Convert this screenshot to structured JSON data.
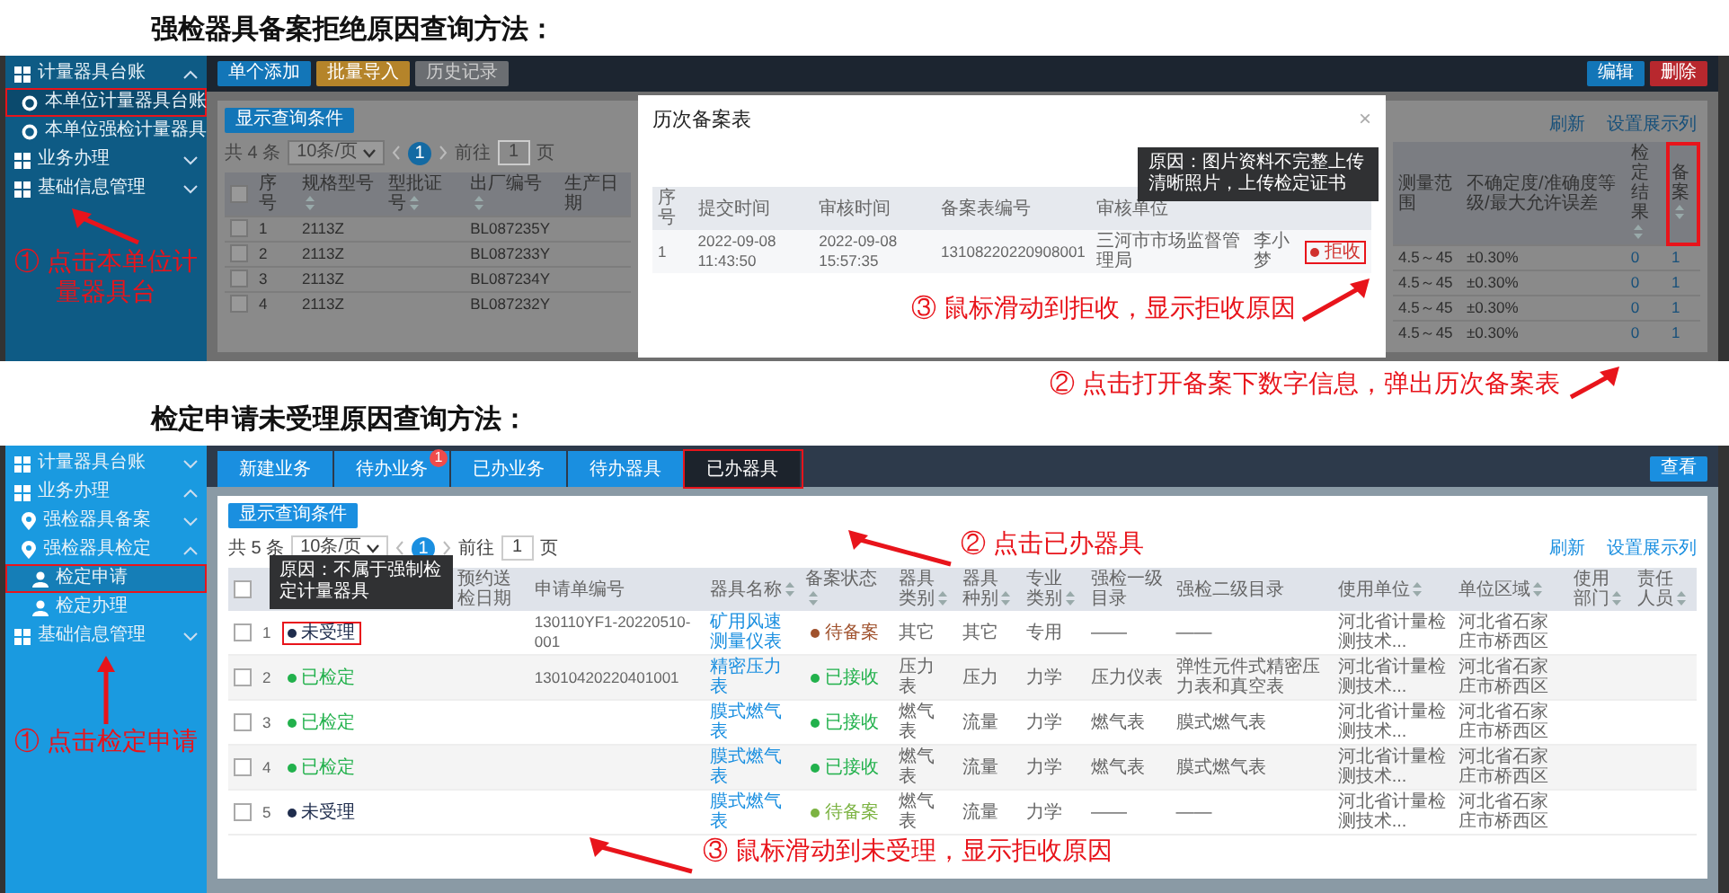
{
  "section_1": {
    "heading": "强检器具备案拒绝原因查询方法：",
    "sidebar": [
      {
        "label": "计量器具台账",
        "expanded": true,
        "children": [
          {
            "label": "本单位计量器具台账",
            "selected": true,
            "highlighted": true
          },
          {
            "label": "本单位强检计量器具",
            "selected": false,
            "highlighted": false
          }
        ]
      },
      {
        "label": "业务办理",
        "expanded": false
      },
      {
        "label": "基础信息管理",
        "expanded": false
      }
    ],
    "sidebar_note": "① 点击本单位计量器具台",
    "toolbar_buttons": [
      {
        "label": "单个添加",
        "kind": "primary"
      },
      {
        "label": "批量导入",
        "kind": "warning"
      },
      {
        "label": "历史记录",
        "kind": "disabled"
      }
    ],
    "action_buttons": [
      {
        "label": "编辑",
        "kind": "primary"
      },
      {
        "label": "删除",
        "kind": "danger"
      }
    ],
    "query_button": "显示查询条件",
    "pager": {
      "total": "共 4 条",
      "page_size": "10条/页",
      "pages": [
        {
          "label": "1",
          "selected": true
        }
      ],
      "goto_prefix": "前往",
      "goto_value": "1",
      "goto_suffix": "页"
    },
    "table_links": [
      "刷新",
      "设置展示列"
    ],
    "header_checked": false,
    "left_columns": [
      {
        "label": "序号",
        "sortable": false
      },
      {
        "label": "规格型号",
        "sortable": true
      },
      {
        "label": "型批证号",
        "sortable": true
      },
      {
        "label": "出厂编号",
        "sortable": true
      },
      {
        "label": "生产日期",
        "sortable": false
      }
    ],
    "left_rows": [
      {
        "checked": false,
        "cells": [
          "1",
          "2113Z",
          null,
          "BL087235Y",
          null
        ]
      },
      {
        "checked": false,
        "cells": [
          "2",
          "2113Z",
          null,
          "BL087233Y",
          null
        ]
      },
      {
        "checked": false,
        "cells": [
          "3",
          "2113Z",
          null,
          "BL087234Y",
          null
        ]
      },
      {
        "checked": false,
        "cells": [
          "4",
          "2113Z",
          null,
          "BL087232Y",
          null
        ]
      }
    ],
    "right_columns": [
      {
        "label": "测量范围",
        "sortable": false,
        "kind": "text",
        "highlighted": false
      },
      {
        "label": "不确定度/准确度等级/最大允许误差",
        "sortable": false,
        "kind": "text",
        "highlighted": false
      },
      {
        "label": "检定结果",
        "sortable": true,
        "kind": "link",
        "highlighted": false
      },
      {
        "label": "备案",
        "sortable": true,
        "kind": "link",
        "highlighted": true
      }
    ],
    "right_rows": [
      [
        "4.5～45",
        "±0.30%",
        "0",
        "1"
      ],
      [
        "4.5～45",
        "±0.30%",
        "0",
        "1"
      ],
      [
        "4.5～45",
        "±0.30%",
        "0",
        "1"
      ],
      [
        "4.5～45",
        "±0.30%",
        "0",
        "1"
      ]
    ],
    "modal": {
      "title": "历次备案表",
      "close": "×",
      "columns": [
        "序号",
        "提交时间",
        "审核时间",
        "备案表编号",
        "审核单位"
      ],
      "rows": [
        {
          "cells": [
            "1",
            "2022-09-08 11:43:50",
            "2022-09-08 15:57:35",
            "13108220220908001",
            "三河市市场监督管理局",
            "李小梦"
          ],
          "status": {
            "label": "拒收",
            "color": "#d0312d",
            "highlighted": true
          }
        }
      ],
      "tooltip": "原因：图片资料不完整上传清晰照片，上传检定证书",
      "note": "③ 鼠标滑动到拒收，显示拒收原因"
    },
    "note": "② 点击打开备案下数字信息，弹出历次备案表"
  },
  "section_2": {
    "heading": "检定申请未受理原因查询方法：",
    "sidebar": [
      {
        "label": "计量器具台账",
        "expanded": false
      },
      {
        "label": "业务办理",
        "expanded": true,
        "children": [
          {
            "label": "强检器具备案",
            "expanded": false
          },
          {
            "label": "强检器具检定",
            "expanded": true,
            "children": [
              {
                "label": "检定申请",
                "selected": true,
                "highlighted": true
              },
              {
                "label": "检定办理",
                "selected": false,
                "highlighted": false
              }
            ]
          }
        ]
      },
      {
        "label": "基础信息管理",
        "expanded": false
      }
    ],
    "sidebar_note": "① 点击检定申请",
    "tabs": [
      {
        "label": "新建业务",
        "selected": false,
        "highlighted": false
      },
      {
        "label": "待办业务",
        "selected": false,
        "highlighted": false,
        "badge": "1"
      },
      {
        "label": "已办业务",
        "selected": false,
        "highlighted": false
      },
      {
        "label": "待办器具",
        "selected": false,
        "highlighted": false
      },
      {
        "label": "已办器具",
        "selected": true,
        "highlighted": true
      }
    ],
    "action_buttons": [
      {
        "label": "查看",
        "kind": "primary"
      }
    ],
    "tab_note": "② 点击已办器具",
    "query_button": "显示查询条件",
    "pager": {
      "total": "共 5 条",
      "page_size": "10条/页",
      "pages": [
        {
          "label": "1",
          "selected": true
        }
      ],
      "goto_prefix": "前往",
      "goto_value": "1",
      "goto_suffix": "页"
    },
    "table_links": [
      "刷新",
      "设置展示列"
    ],
    "header_checked": false,
    "columns": [
      {
        "kind": "text"
      },
      {
        "kind": "status"
      },
      {
        "label": "预约送检日期",
        "sortable": false
      },
      {
        "label": "申请单编号",
        "kind": "text",
        "sortable": false
      },
      {
        "label": "器具名称",
        "kind": "link",
        "sortable": true
      },
      {
        "label": "备案状态",
        "kind": "status",
        "sortable": true
      },
      {
        "label": "器具类别",
        "kind": "text",
        "sortable": true
      },
      {
        "label": "器具种别",
        "kind": "text",
        "sortable": true
      },
      {
        "label": "专业类别",
        "kind": "text",
        "sortable": true
      },
      {
        "label": "强检一级目录",
        "kind": "text",
        "sortable": false
      },
      {
        "label": "强检二级目录",
        "kind": "text",
        "sortable": false
      },
      {
        "label": "使用单位",
        "kind": "text",
        "sortable": true
      },
      {
        "label": "单位区域",
        "kind": "text",
        "sortable": true
      },
      {
        "label": "使用部门",
        "sortable": true
      },
      {
        "label": "责任人员",
        "sortable": true
      }
    ],
    "rows": [
      {
        "checked": false,
        "cells": [
          "1",
          {
            "text": "未受理",
            "color": "#1f2d4d",
            "highlighted": true,
            "tooltip": "原因：不属于强制检定计量器具"
          },
          null,
          "130110YF1-20220510-001",
          "矿用风速测量仪表",
          {
            "text": "待备案",
            "color": "#a0522d"
          },
          "其它",
          "其它",
          "专用",
          "——",
          "——",
          "河北省计量检测技术...",
          "河北省石家庄市桥西区",
          null,
          null
        ]
      },
      {
        "checked": false,
        "cells": [
          "2",
          {
            "text": "已检定",
            "color": "#22b14c"
          },
          null,
          "13010420220401001",
          "精密压力表",
          {
            "text": "已接收",
            "color": "#22b14c"
          },
          "压力表",
          "压力",
          "力学",
          "压力仪表",
          "弹性元件式精密压力表和真空表",
          "河北省计量检测技术...",
          "河北省石家庄市桥西区",
          null,
          null
        ]
      },
      {
        "checked": false,
        "cells": [
          "3",
          {
            "text": "已检定",
            "color": "#22b14c"
          },
          null,
          null,
          "膜式燃气表",
          {
            "text": "已接收",
            "color": "#22b14c"
          },
          "燃气表",
          "流量",
          "力学",
          "燃气表",
          "膜式燃气表",
          "河北省计量检测技术...",
          "河北省石家庄市桥西区",
          null,
          null
        ]
      },
      {
        "checked": false,
        "cells": [
          "4",
          {
            "text": "已检定",
            "color": "#22b14c"
          },
          null,
          null,
          "膜式燃气表",
          {
            "text": "已接收",
            "color": "#22b14c"
          },
          "燃气表",
          "流量",
          "力学",
          "燃气表",
          "膜式燃气表",
          "河北省计量检测技术...",
          "河北省石家庄市桥西区",
          null,
          null
        ]
      },
      {
        "checked": false,
        "cells": [
          "5",
          {
            "text": "未受理",
            "color": "#1f2d4d"
          },
          null,
          null,
          "膜式燃气表",
          {
            "text": "待备案",
            "color": "#7cb342"
          },
          "燃气表",
          "流量",
          "力学",
          "——",
          "——",
          "河北省计量检测技术...",
          "河北省石家庄市桥西区",
          null,
          null
        ]
      }
    ],
    "note": "③ 鼠标滑动到未受理，显示拒收原因"
  }
}
